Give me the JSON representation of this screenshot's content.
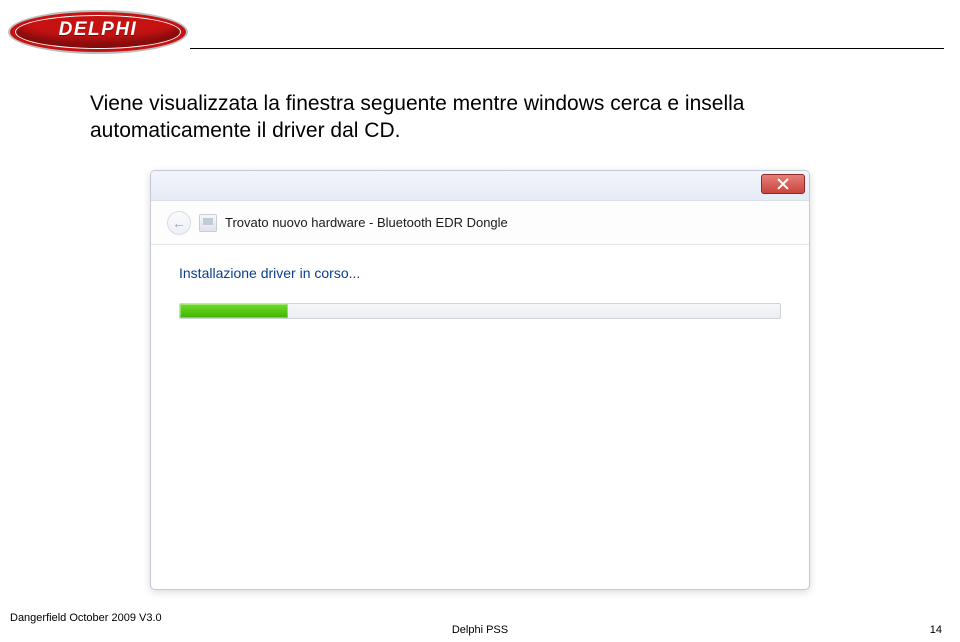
{
  "logo_text": "DELPHI",
  "body_paragraph": "Viene visualizzata la finestra seguente mentre windows cerca e insella automaticamente il driver dal CD.",
  "dialog": {
    "title": "Trovato nuovo hardware - Bluetooth EDR Dongle",
    "install_label": "Installazione driver in corso...",
    "progress_percent": 18
  },
  "footer": {
    "left": "Dangerfield October 2009 V3.0",
    "center": "Delphi PSS",
    "page_number": "14"
  }
}
